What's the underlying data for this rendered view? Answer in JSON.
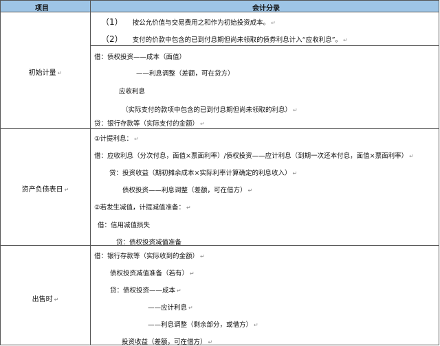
{
  "header": {
    "col1": "项目",
    "col2": "会计分录"
  },
  "rows": [
    {
      "name": "初始计量",
      "intro": [
        {
          "no": "（1）",
          "text": "按公允价值与交易费用之和作为初始投资成本。"
        },
        {
          "no": "（2）",
          "text": "支付的价款中包含的已到付息期但尚未领取的债券利息计入“应收利息”。"
        }
      ],
      "entries": [
        "借：债权投资——成本（面值）",
        "——利息调整（差额，可在贷方）",
        "应收利息",
        "（实际支付的款项中包含的已到付息期但尚未领取的利息）",
        "贷：银行存款等（实际支付的金额）"
      ]
    },
    {
      "name": "资产负债表日",
      "entries": [
        "①计提利息：",
        "借：应收利息（分次付息，面值×票面利率）/债权投资——应计利息（到期一次还本付息，面值×票面利率）",
        "贷：投资收益（期初摊余成本×实际利率计算确定的利息收入）",
        "债权投资——利息调整（差额，可在借方）",
        "②若发生减值，计提减值准备：",
        "借：信用减值损失",
        "贷：债权投资减值准备"
      ]
    },
    {
      "name": "出售时",
      "entries": [
        "借：银行存款等（实际收到的金额）",
        "债权投资减值准备（若有）",
        "贷：债权投资——成本",
        "——应计利息",
        "——利息调整（剩余部分，或借方）",
        "投资收益（差额，可在借方）"
      ]
    }
  ],
  "mark": "↵"
}
